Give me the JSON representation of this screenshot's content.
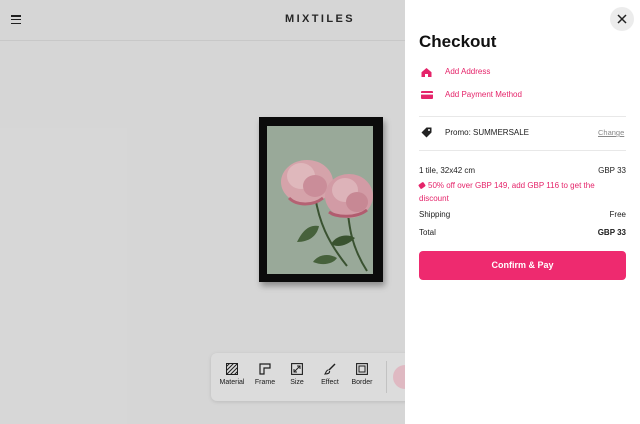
{
  "header": {
    "brand": "MIXTILES",
    "menu_icon": "hamburger-menu-icon"
  },
  "editor": {
    "tools": [
      {
        "label": "Material",
        "icon": "material-hatch-icon"
      },
      {
        "label": "Frame",
        "icon": "frame-corner-icon"
      },
      {
        "label": "Size",
        "icon": "resize-icon"
      },
      {
        "label": "Effect",
        "icon": "brush-icon"
      },
      {
        "label": "Border",
        "icon": "border-square-icon"
      }
    ]
  },
  "checkout": {
    "title": "Checkout",
    "add_address": "Add Address",
    "add_payment": "Add Payment Method",
    "promo_label": "Promo: SUMMERSALE",
    "promo_change": "Change",
    "item_desc": "1 tile, 32x42 cm",
    "item_price": "GBP 33",
    "discount_note": "50% off over GBP 149, add GBP 116 to get the discount",
    "shipping_label": "Shipping",
    "shipping_value": "Free",
    "total_label": "Total",
    "total_value": "GBP 33",
    "pay_button": "Confirm & Pay"
  },
  "colors": {
    "accent": "#ee2a6f",
    "link": "#e5246a"
  }
}
